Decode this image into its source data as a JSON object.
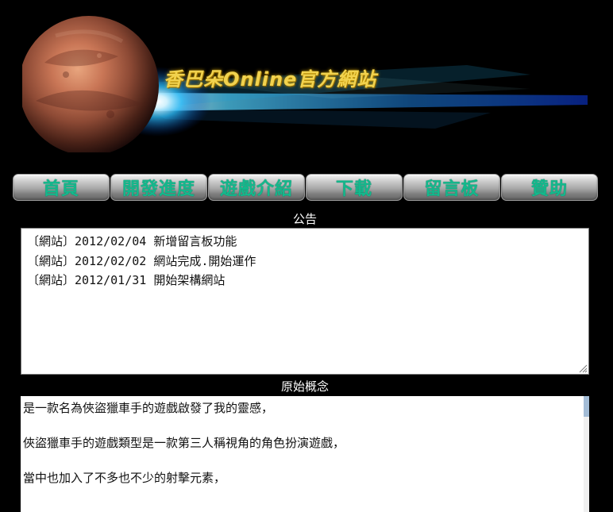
{
  "header": {
    "site_title": "香巴朵Online官方網站"
  },
  "nav": {
    "items": [
      {
        "label": "首頁"
      },
      {
        "label": "開發進度"
      },
      {
        "label": "遊戲介紹"
      },
      {
        "label": "下載"
      },
      {
        "label": "留言板"
      },
      {
        "label": "贊助"
      }
    ]
  },
  "announcements": {
    "label": "公告",
    "items": [
      "〔網站〕2012/02/04 新增留言板功能",
      "〔網站〕2012/02/02 網站完成.開始運作",
      "〔網站〕2012/01/31 開始架構網站"
    ]
  },
  "concept": {
    "label": "原始概念",
    "paragraphs": [
      "是一款名為俠盜獵車手的遊戲啟發了我的靈感，",
      "俠盜獵車手的遊戲類型是一款第三人稱視角的角色扮演遊戲，",
      "當中也加入了不多也不少的射擊元素，"
    ]
  },
  "colors": {
    "background": "#000000",
    "nav_text": "#14b88c",
    "title_text": "#f1d24e"
  }
}
